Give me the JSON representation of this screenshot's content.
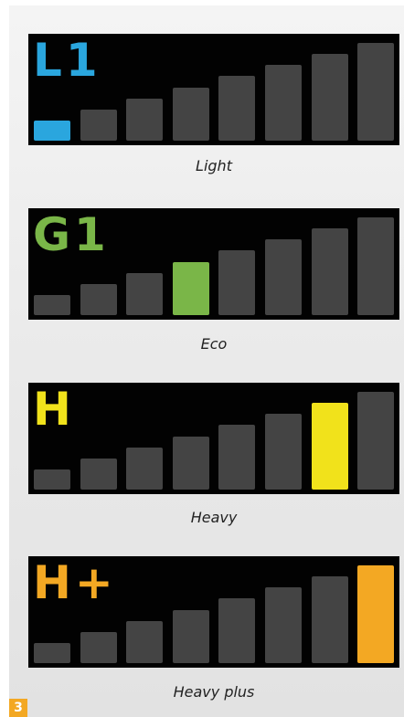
{
  "modes": [
    {
      "code": "L1",
      "caption": "Light",
      "color": "#2aa6de",
      "level": 1
    },
    {
      "code": "G1",
      "caption": "Eco",
      "color": "#7ab648",
      "level": 4
    },
    {
      "code": "H",
      "caption": "Heavy",
      "color": "#f1e21b",
      "level": 7
    },
    {
      "code": "H+",
      "caption": "Heavy plus",
      "color": "#f3a823",
      "level": 8
    }
  ],
  "bars_per_display": 8,
  "bar_inactive_color": "#444444",
  "page_badge": "3"
}
